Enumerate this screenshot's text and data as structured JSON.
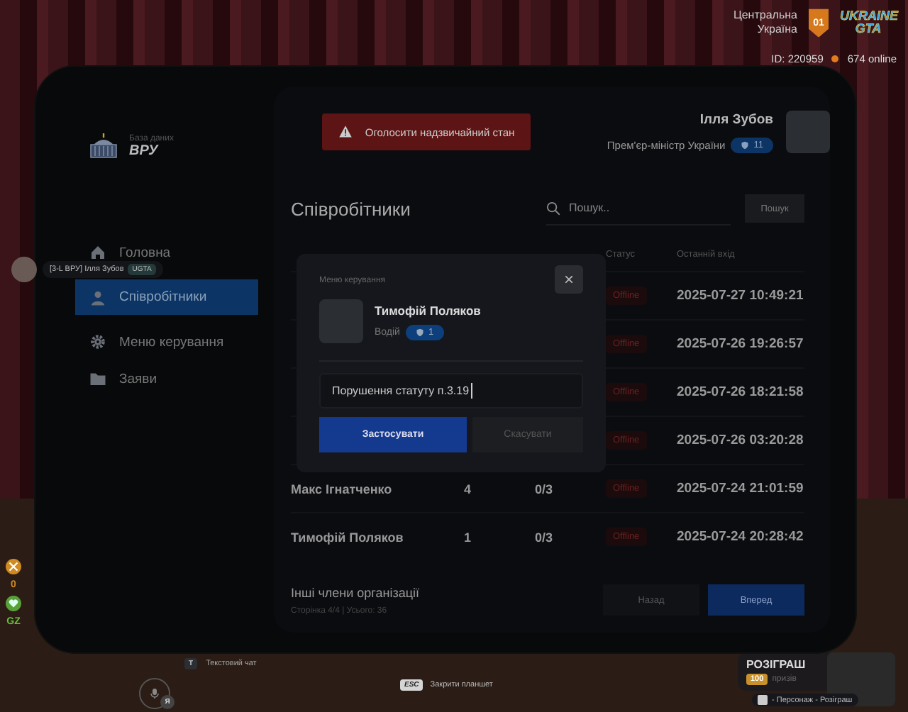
{
  "hud": {
    "region": "Центральна Україна",
    "region_badge": "01",
    "logo": "UKRAINE GTA",
    "player_id": "ID: 220959",
    "online": "674 online"
  },
  "nametag": {
    "text": "[3-L ВРУ] Ілля Зубов",
    "badge": "UGTA"
  },
  "status_hud": {
    "value": "0",
    "zone": "GZ"
  },
  "bottom": {
    "chat_key": "T",
    "chat_label": "Текстовий чат",
    "mic_key": "Я",
    "esc_key": "ESC",
    "esc_label": "Закрити планшет"
  },
  "giveaway": {
    "title": "РОЗІГРАШ",
    "count": "100",
    "unit": "призів",
    "hint": "- Персонаж - Розіграш"
  },
  "tablet": {
    "brand": {
      "caption": "База даних",
      "name": "ВРУ"
    },
    "alert_button": "Оголосити надзвичайний стан",
    "user": {
      "name": "Ілля Зубов",
      "role": "Прем'єр-міністр України",
      "rank": "11"
    },
    "sidebar": {
      "items": [
        {
          "label": "Головна",
          "selected": false
        },
        {
          "label": "Співробітники",
          "selected": true
        },
        {
          "label": "Меню керування",
          "selected": false
        },
        {
          "label": "Заяви",
          "selected": false
        }
      ]
    },
    "title": "Співробітники",
    "search": {
      "placeholder": "Пошук..",
      "button": "Пошук"
    },
    "table": {
      "columns": [
        {
          "label": "Статус"
        },
        {
          "label": "Останній вхід"
        }
      ],
      "rows": [
        {
          "status": "Offline",
          "last_login": "2025-07-27 10:49:21"
        },
        {
          "status": "Offline",
          "last_login": "2025-07-26 19:26:57"
        },
        {
          "status": "Offline",
          "last_login": "2025-07-26 18:21:58"
        },
        {
          "status": "Offline",
          "last_login": "2025-07-26 03:20:28"
        },
        {
          "name": "Макс Ігнатченко",
          "rank": "4",
          "warnings": "0/3",
          "status": "Offline",
          "last_login": "2025-07-24 21:01:59"
        },
        {
          "name": "Тимофій Поляков",
          "rank": "1",
          "warnings": "0/3",
          "status": "Offline",
          "last_login": "2025-07-24 20:28:42"
        }
      ]
    },
    "footer": {
      "title": "Інші члени організації",
      "info": "Сторінка 4/4 | Усього: 36",
      "prev": "Назад",
      "next": "Вперед"
    }
  },
  "modal": {
    "title": "Меню керування",
    "close": "×",
    "person": {
      "name": "Тимофій Поляков",
      "role": "Водій",
      "rank": "1"
    },
    "reason": {
      "value": "Порушення статуту п.3.19"
    },
    "apply": "Застосувати",
    "cancel": "Скасувати"
  }
}
